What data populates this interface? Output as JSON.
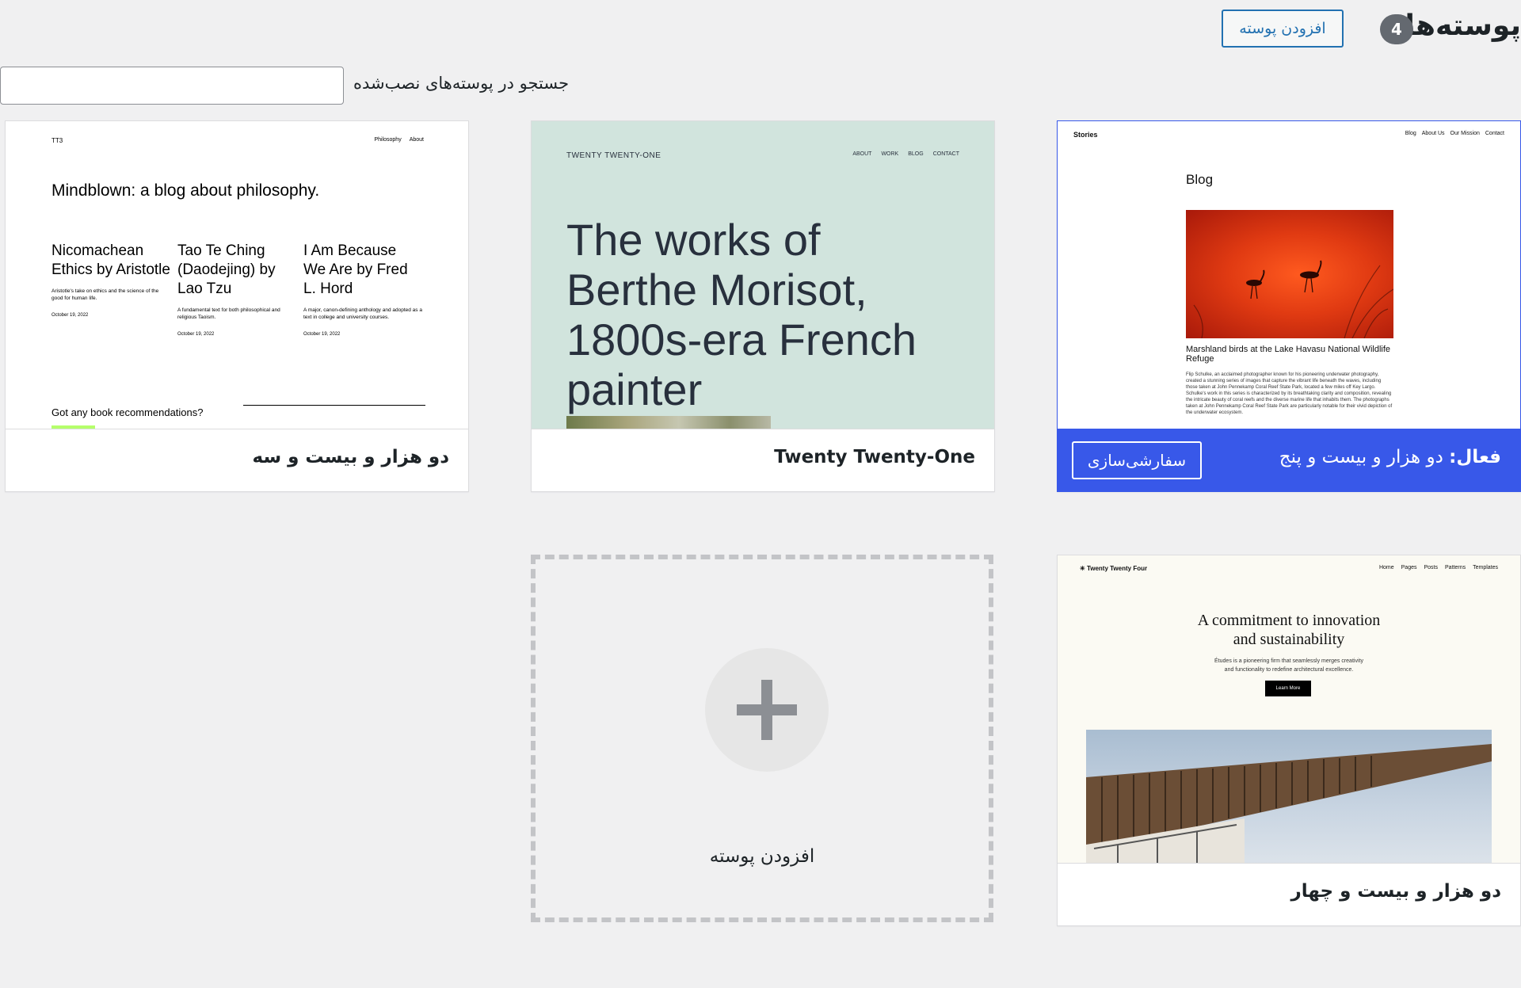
{
  "header": {
    "title": "پوسته‌ها",
    "count": "4",
    "add_button": "افزودن پوسته",
    "search_label": "جستجو در پوسته‌های نصب‌شده",
    "search_value": ""
  },
  "themes": {
    "tt5": {
      "active_prefix": "فعال:",
      "name": "دو هزار و بیست و پنج",
      "customize": "سفارشی‌سازی",
      "preview": {
        "logo": "Stories",
        "nav": [
          "Blog",
          "About Us",
          "Our Mission",
          "Contact"
        ],
        "heading": "Blog",
        "caption": "Marshland birds at the Lake Havasu National Wildlife Refuge",
        "body": "Flip Schulke, an acclaimed photographer known for his pioneering underwater photography, created a stunning series of images that capture the vibrant life beneath the waves, including those taken at John Pennekamp Coral Reef State Park, located a few miles off Key Largo. Schulke's work in this series is characterized by its breathtaking clarity and composition, revealing the intricate beauty of coral reefs and the diverse marine life that inhabits them. The photographs taken at John Pennekamp Coral Reef State Park are particularly notable for their vivid depiction of the underwater ecosystem."
      }
    },
    "tt1": {
      "name": "Twenty Twenty-One",
      "preview": {
        "logo": "TWENTY TWENTY-ONE",
        "nav": [
          "ABOUT",
          "WORK",
          "BLOG",
          "CONTACT"
        ],
        "hero": "The works of Berthe Morisot, 1800s-era French painter"
      }
    },
    "tt3": {
      "name": "دو هزار و بیست و سه",
      "preview": {
        "logo": "TT3",
        "nav": [
          "Philosophy",
          "About"
        ],
        "headline": "Mindblown: a blog about philosophy.",
        "posts": [
          {
            "title": "Nicomachean Ethics by Aristotle",
            "desc": "Aristotle's take on ethics and the science of the good for human life.",
            "date": "October 19, 2022"
          },
          {
            "title": "Tao Te Ching (Daodejing) by Lao Tzu",
            "desc": "A fundamental text for both philosophical and religious Taoism.",
            "date": "October 19, 2022"
          },
          {
            "title": "I Am Because We Are by Fred L. Hord",
            "desc": "A major, canon-defining anthology and adopted as a text in college and university courses.",
            "date": "October 19, 2022"
          }
        ],
        "ask": "Got any book recommendations?"
      }
    },
    "tt4": {
      "name": "دو هزار و بیست و چهار",
      "preview": {
        "logo": "Twenty Twenty Four",
        "nav": [
          "Home",
          "Pages",
          "Posts",
          "Patterns",
          "Templates"
        ],
        "hero_line1": "A commitment to innovation",
        "hero_line2": "and sustainability",
        "sub_line1": "Études is a pioneering firm that seamlessly merges creativity",
        "sub_line2": "and functionality to redefine architectural excellence.",
        "button": "Learn More"
      }
    }
  },
  "add_new": {
    "label": "افزودن پوسته"
  }
}
